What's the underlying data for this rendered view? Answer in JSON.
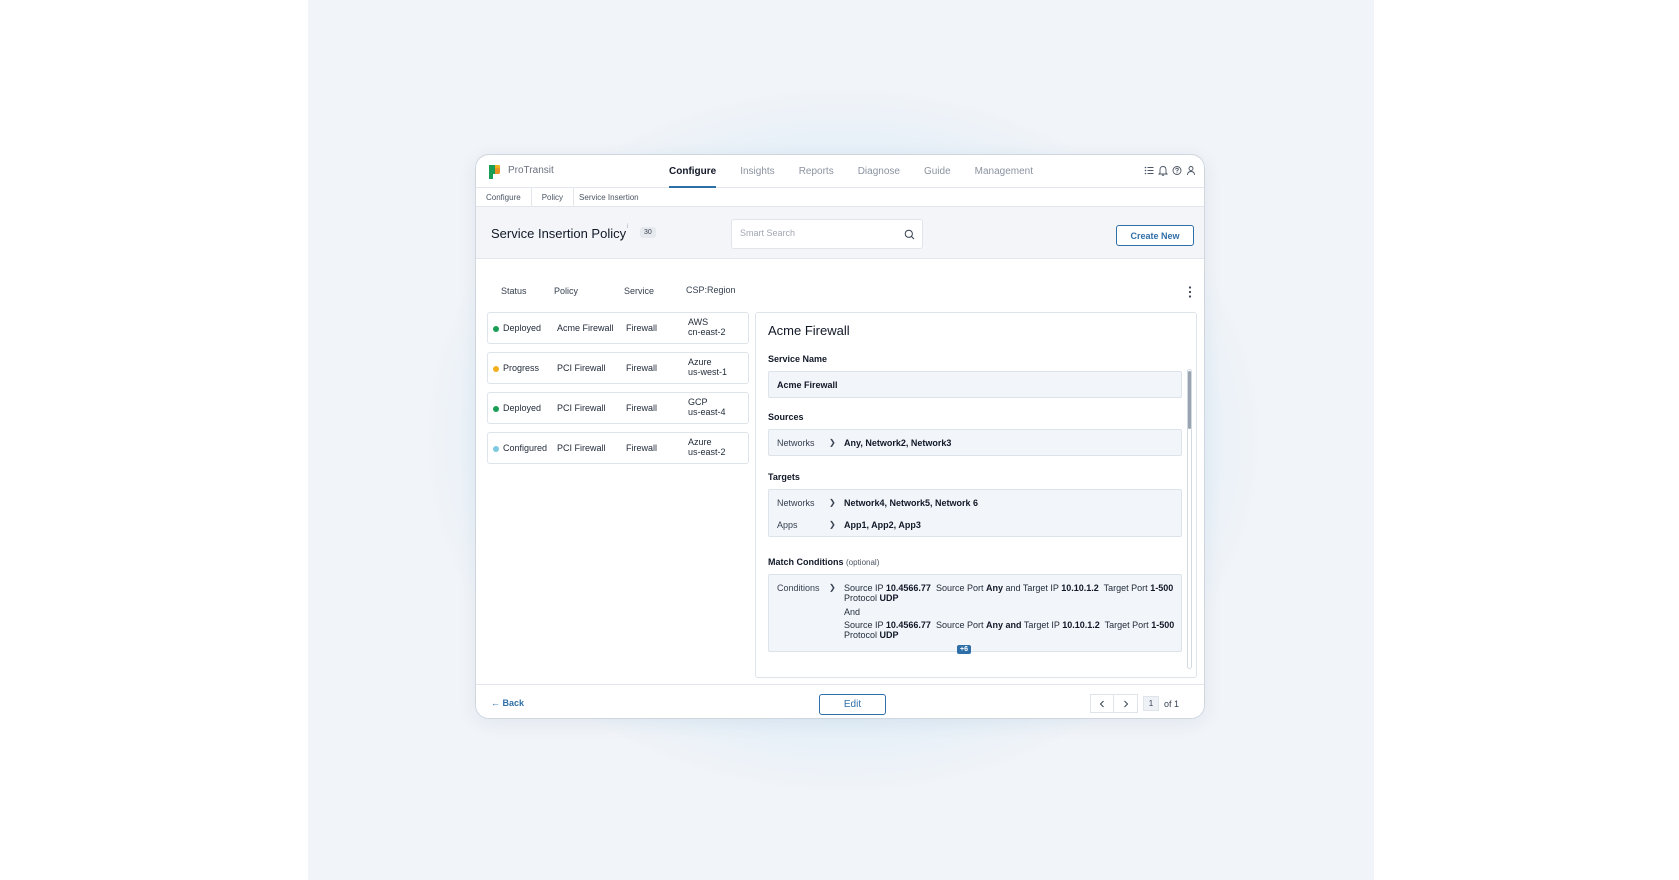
{
  "app": {
    "brand": "ProTransit"
  },
  "nav": {
    "links": [
      "Configure",
      "Insights",
      "Reports",
      "Diagnose",
      "Guide",
      "Management"
    ],
    "active": "Configure",
    "icons": [
      "list-icon",
      "bell-icon",
      "help-icon",
      "user-icon"
    ]
  },
  "breadcrumb": [
    "Configure",
    "Policy",
    "Service Insertion"
  ],
  "header": {
    "title": "Service Insertion Policy",
    "title_sup": "i",
    "count": "30",
    "search_placeholder": "Smart Search",
    "create_label": "Create New"
  },
  "table": {
    "columns": [
      "Status",
      "Policy",
      "Service",
      "CSP:Region"
    ],
    "rows": [
      {
        "status": "Deployed",
        "status_color": "#1a9e55",
        "policy": "Acme Firewall",
        "service": "Firewall",
        "csp": "AWS",
        "region": "cn-east-2"
      },
      {
        "status": "Progress",
        "status_color": "#f2b01e",
        "policy": "PCI Firewall",
        "service": "Firewall",
        "csp": "Azure",
        "region": "us-west-1"
      },
      {
        "status": "Deployed",
        "status_color": "#1a9e55",
        "policy": "PCI Firewall",
        "service": "Firewall",
        "csp": "GCP",
        "region": "us-east-4"
      },
      {
        "status": "Configured",
        "status_color": "#7cc9e0",
        "policy": "PCI Firewall",
        "service": "Firewall",
        "csp": "Azure",
        "region": "us-east-2"
      }
    ]
  },
  "detail": {
    "title": "Acme Firewall",
    "service_name_label": "Service Name",
    "service_name": "Acme Firewall",
    "sources_label": "Sources",
    "sources": {
      "key": "Networks",
      "value": "Any, Network2, Network3"
    },
    "targets_label": "Targets",
    "targets": [
      {
        "key": "Networks",
        "value": "Network4, Network5, Network 6"
      },
      {
        "key": "Apps",
        "value": "App1, App2, App3"
      }
    ],
    "match_label": "Match Conditions",
    "match_optional": "(optional)",
    "conditions_key": "Conditions",
    "condition": {
      "source_ip_label": "Source IP",
      "source_ip": "10.4566.77",
      "source_port_label": "Source Port",
      "source_port": "Any",
      "and_word": "and",
      "target_ip_label": "Target IP",
      "target_ip": "10.10.1.2",
      "target_port_label": "Target Port",
      "target_port": "1-500",
      "protocol_label": "Protocol",
      "protocol": "UDP"
    },
    "joiner": "And",
    "more_badge": "+6"
  },
  "footer": {
    "back_label": "← Back",
    "edit_label": "Edit",
    "page": "1",
    "of_label": "of 1"
  },
  "colors": {
    "accent": "#2f6fa8",
    "deployed": "#1a9e55",
    "progress": "#f2b01e",
    "configured": "#7cc9e0"
  }
}
